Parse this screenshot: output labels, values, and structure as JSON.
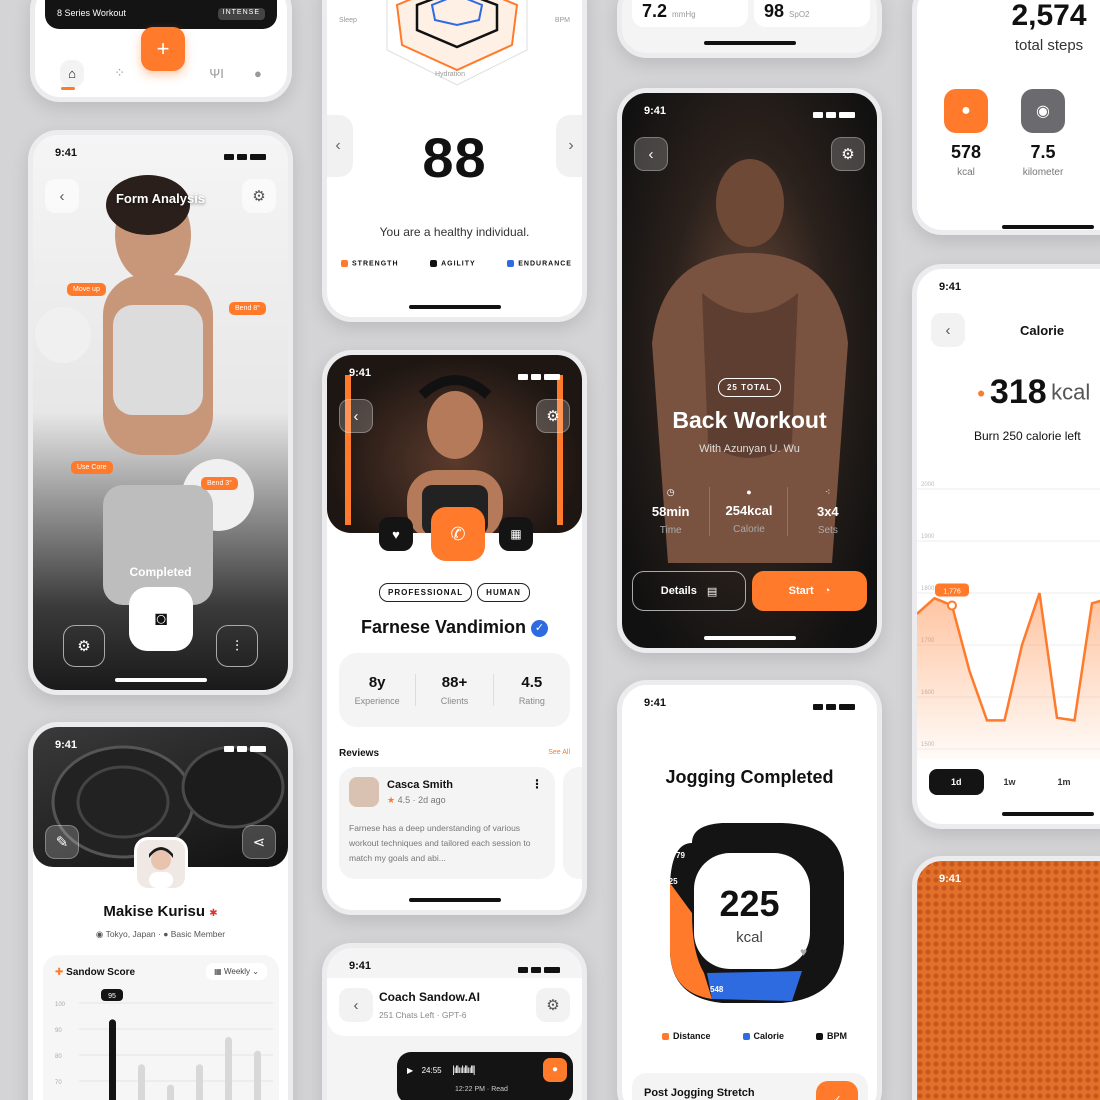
{
  "colors": {
    "accent": "#ff7a2a",
    "dark": "#141414",
    "blue": "#2f6be0"
  },
  "p1": {
    "series_label": "8 Series Workout",
    "intense_label": "INTENSE",
    "fab_icon": "plus-icon",
    "nav": [
      "home-icon",
      "activity-icon",
      "food-icon",
      "profile-icon"
    ]
  },
  "p2": {
    "labels": {
      "sleep": "Sleep",
      "bpm": "BPM",
      "hydration": "Hydration"
    },
    "score": "88",
    "message": "You are a healthy individual.",
    "legend": [
      "STRENGTH",
      "AGILITY",
      "ENDURANCE"
    ]
  },
  "p3": {
    "v1": "7.2",
    "u1": "mmHg",
    "v2": "98",
    "u2": "SpO2"
  },
  "p4": {
    "steps": "2,574",
    "steps_label": "total steps",
    "kcal": "578",
    "kcal_label": "kcal",
    "km": "7.5",
    "km_label": "kilometer"
  },
  "p5": {
    "time": "9:41",
    "title": "Form Analysis",
    "tags": [
      "Move up",
      "Bend 8°",
      "Use Core",
      "Bend 3°"
    ],
    "status": "Completed"
  },
  "p6": {
    "time": "9:41",
    "badge": "25 TOTAL",
    "title": "Back Workout",
    "subtitle": "With Azunyan U. Wu",
    "stats": [
      {
        "v": "58min",
        "l": "Time"
      },
      {
        "v": "254kcal",
        "l": "Calorie"
      },
      {
        "v": "3x4",
        "l": "Sets"
      }
    ],
    "details_label": "Details",
    "start_label": "Start"
  },
  "p7": {
    "time": "9:41",
    "tags": [
      "PROFESSIONAL",
      "HUMAN"
    ],
    "name": "Farnese Vandimion",
    "stats": [
      {
        "v": "8y",
        "l": "Experience"
      },
      {
        "v": "88+",
        "l": "Clients"
      },
      {
        "v": "4.5",
        "l": "Rating"
      }
    ],
    "reviews_label": "Reviews",
    "see_all": "See All",
    "review": {
      "name": "Casca Smith",
      "rating": "4.5",
      "ago": "2d ago",
      "text": "Farnese has a deep understanding of various workout techniques and tailored each session to match my goals and abi..."
    }
  },
  "p8": {
    "time": "9:41",
    "title": "Calorie",
    "value": "318",
    "unit": "kcal",
    "subtitle": "Burn 250 calorie left",
    "yticks": [
      "2000",
      "1900",
      "1800",
      "1700",
      "1600",
      "1500"
    ],
    "tooltip": "1,776",
    "ranges": [
      "1d",
      "1w",
      "1m"
    ]
  },
  "chart_data": {
    "type": "area",
    "ylim": [
      1500,
      2000
    ],
    "x": [
      0,
      1,
      2,
      3,
      4,
      5,
      6,
      7,
      8,
      9,
      10,
      11,
      12
    ],
    "values": [
      1760,
      1790,
      1776,
      1650,
      1555,
      1555,
      1700,
      1800,
      1560,
      1555,
      1780,
      1790,
      1780
    ]
  },
  "p9": {
    "time": "9:41",
    "name": "Makise Kurisu",
    "location": "Tokyo, Japan",
    "member": "Basic Member",
    "score_label": "Sandow Score",
    "range": "Weekly",
    "peak": "95",
    "yticks": [
      "100",
      "90",
      "80",
      "70"
    ]
  },
  "p10": {
    "time": "9:41",
    "title": "Jogging Completed",
    "value": "225",
    "unit": "kcal",
    "seg": {
      "a": "79",
      "b": "1.25",
      "c": "548"
    },
    "legend": [
      "Distance",
      "Calorie",
      "BPM"
    ],
    "footer": "Post Jogging Stretch"
  },
  "p11": {
    "time": "9:41",
    "title": "Coach Sandow.AI",
    "subtitle": "251 Chats Left",
    "model": "GPT-6",
    "audio_time": "24:55",
    "sent_time": "12:22 PM",
    "read": "Read"
  },
  "p12": {
    "time": "9:41"
  }
}
